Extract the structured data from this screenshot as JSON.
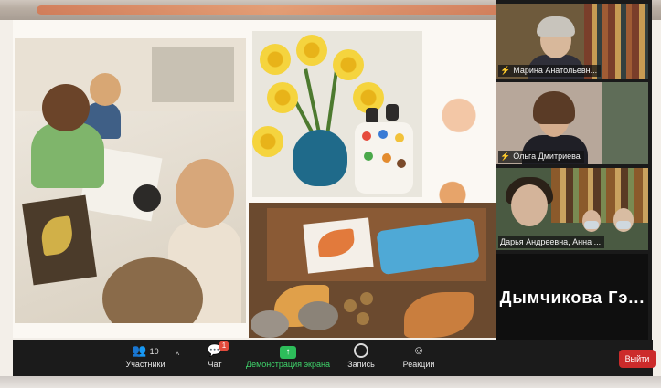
{
  "participants_panel": {
    "tiles": [
      {
        "name": "Марина Анатольевн..."
      },
      {
        "name": "Ольга Дмитриева"
      },
      {
        "name": "Дарья Андреевна, Анна ..."
      },
      {
        "big_name": "Дымчикова Гэ..."
      }
    ]
  },
  "toolbar": {
    "participants_count": "10",
    "participants_label": "Участники",
    "chat_label": "Чат",
    "chat_badge": "1",
    "share_label": "Демонстрация экрана",
    "record_label": "Запись",
    "reactions_label": "Реакции",
    "leave_label": "Выйти"
  },
  "colors": {
    "toolbar_bg": "#1b1b1b",
    "share_green": "#2dbd5a",
    "leave_red": "#cc2b2b",
    "badge_red": "#e24a3b"
  },
  "icons": {
    "participants": "people-icon",
    "chat": "chat-bubble-icon",
    "share": "share-screen-icon",
    "record": "record-icon",
    "reactions": "smiley-plus-icon",
    "mic_muted": "muted-mic-icon"
  }
}
